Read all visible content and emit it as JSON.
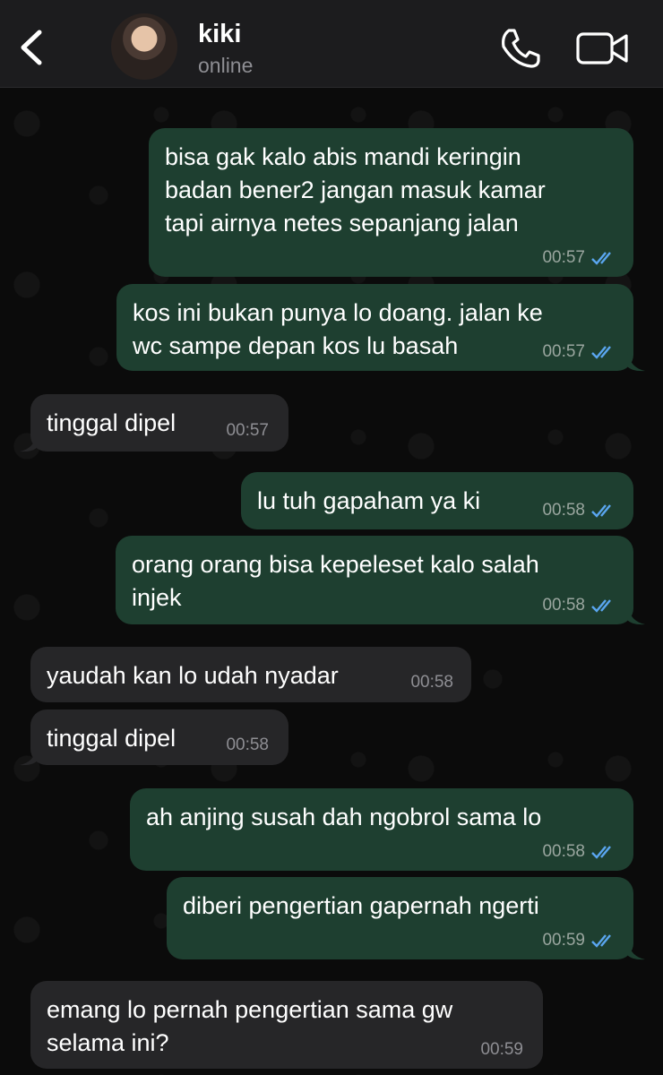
{
  "header": {
    "contact_name": "kiki",
    "status": "online"
  },
  "colors": {
    "outgoing_bubble": "#1e3f30",
    "incoming_bubble": "#262628",
    "read_ticks": "#5aa6f0"
  },
  "messages": [
    {
      "direction": "outgoing",
      "text": "bisa gak kalo abis mandi keringin\nbadan bener2 jangan masuk kamar\ntapi airnya netes sepanjang jalan",
      "time": "00:57",
      "read": true
    },
    {
      "direction": "outgoing",
      "text": "kos ini bukan punya lo doang. jalan ke\nwc sampe depan kos lu basah",
      "time": "00:57",
      "read": true
    },
    {
      "direction": "incoming",
      "text": "tinggal dipel",
      "time": "00:57"
    },
    {
      "direction": "outgoing",
      "text": "lu tuh gapaham ya ki",
      "time": "00:58",
      "read": true
    },
    {
      "direction": "outgoing",
      "text": "orang orang bisa kepeleset kalo salah\ninjek",
      "time": "00:58",
      "read": true
    },
    {
      "direction": "incoming",
      "text": "yaudah kan lo udah nyadar",
      "time": "00:58"
    },
    {
      "direction": "incoming",
      "text": "tinggal dipel",
      "time": "00:58"
    },
    {
      "direction": "outgoing",
      "text": "ah anjing susah dah ngobrol sama lo",
      "time": "00:58",
      "read": true
    },
    {
      "direction": "outgoing",
      "text": "diberi pengertian gapernah ngerti",
      "time": "00:59",
      "read": true
    },
    {
      "direction": "incoming",
      "text": "emang lo pernah pengertian sama gw\nselama ini?",
      "time": "00:59"
    }
  ]
}
